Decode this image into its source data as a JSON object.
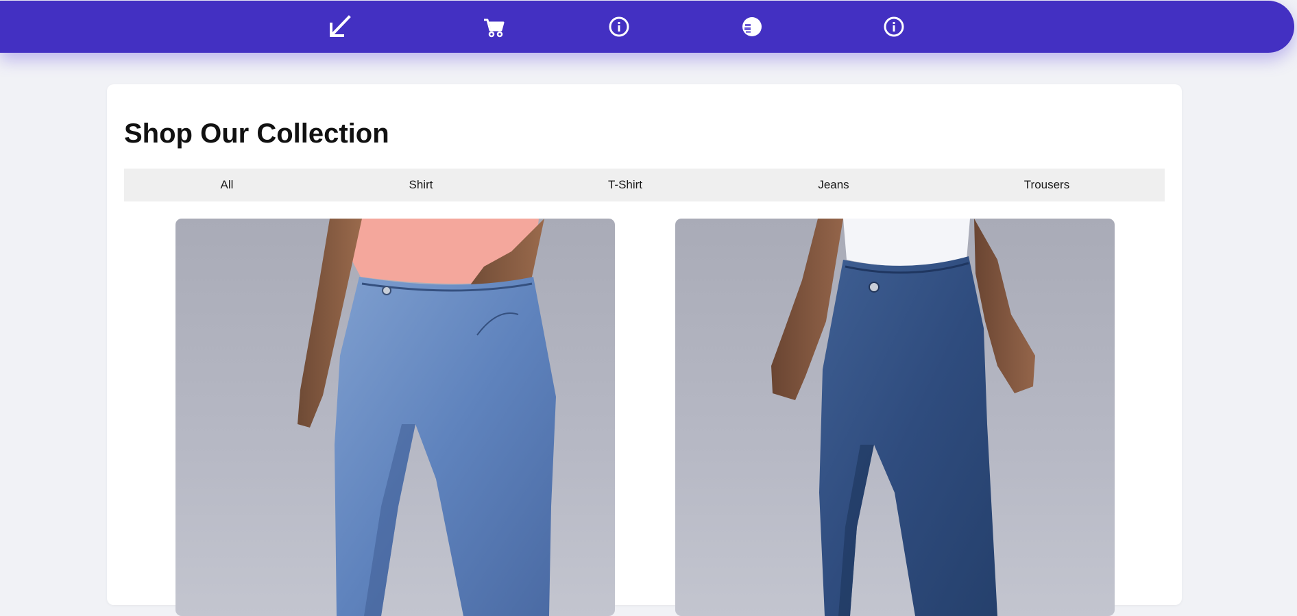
{
  "nav": {
    "items": [
      {
        "icon": "arrow-down-left-icon"
      },
      {
        "icon": "cart-icon"
      },
      {
        "icon": "info-icon"
      },
      {
        "icon": "profile-icon"
      },
      {
        "icon": "info-icon"
      }
    ],
    "color": "#4330c2"
  },
  "page": {
    "title": "Shop Our Collection"
  },
  "filters": {
    "tabs": [
      {
        "label": "All"
      },
      {
        "label": "Shirt"
      },
      {
        "label": "T-Shirt"
      },
      {
        "label": "Jeans"
      },
      {
        "label": "Trousers"
      }
    ]
  },
  "products": [
    {
      "image": "light-blue-jeans-pink-tshirt-photo"
    },
    {
      "image": "dark-blue-jeans-white-tshirt-photo"
    }
  ]
}
